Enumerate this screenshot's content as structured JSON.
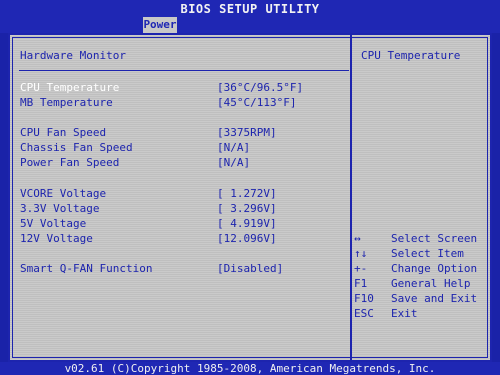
{
  "title": "BIOS SETUP UTILITY",
  "tab": "Power",
  "left_panel": {
    "heading": "Hardware Monitor",
    "items": [
      {
        "label": "CPU Temperature",
        "value": "[36°C/96.5°F]"
      },
      {
        "label": "MB Temperature",
        "value": "[45°C/113°F]"
      },
      {
        "label": "CPU Fan Speed",
        "value": "[3375RPM]"
      },
      {
        "label": "Chassis Fan Speed",
        "value": "[N/A]"
      },
      {
        "label": "Power Fan Speed",
        "value": "[N/A]"
      },
      {
        "label": "VCORE  Voltage",
        "value": "[ 1.272V]"
      },
      {
        "label": "3.3V  Voltage",
        "value": "[ 3.296V]"
      },
      {
        "label": "5V  Voltage",
        "value": "[ 4.919V]"
      },
      {
        "label": "12V  Voltage",
        "value": "[12.096V]"
      },
      {
        "label": "Smart Q-FAN Function",
        "value": "[Disabled]"
      }
    ]
  },
  "right_panel": {
    "heading": "CPU Temperature",
    "help": [
      {
        "key": "↔",
        "desc": "Select Screen"
      },
      {
        "key": "↑↓",
        "desc": "Select Item"
      },
      {
        "key": "+-",
        "desc": "Change Option"
      },
      {
        "key": "F1",
        "desc": "General Help"
      },
      {
        "key": "F10",
        "desc": "Save and Exit"
      },
      {
        "key": "ESC",
        "desc": "Exit"
      }
    ]
  },
  "footer": "v02.61 (C)Copyright 1985-2008, American Megatrends, Inc."
}
